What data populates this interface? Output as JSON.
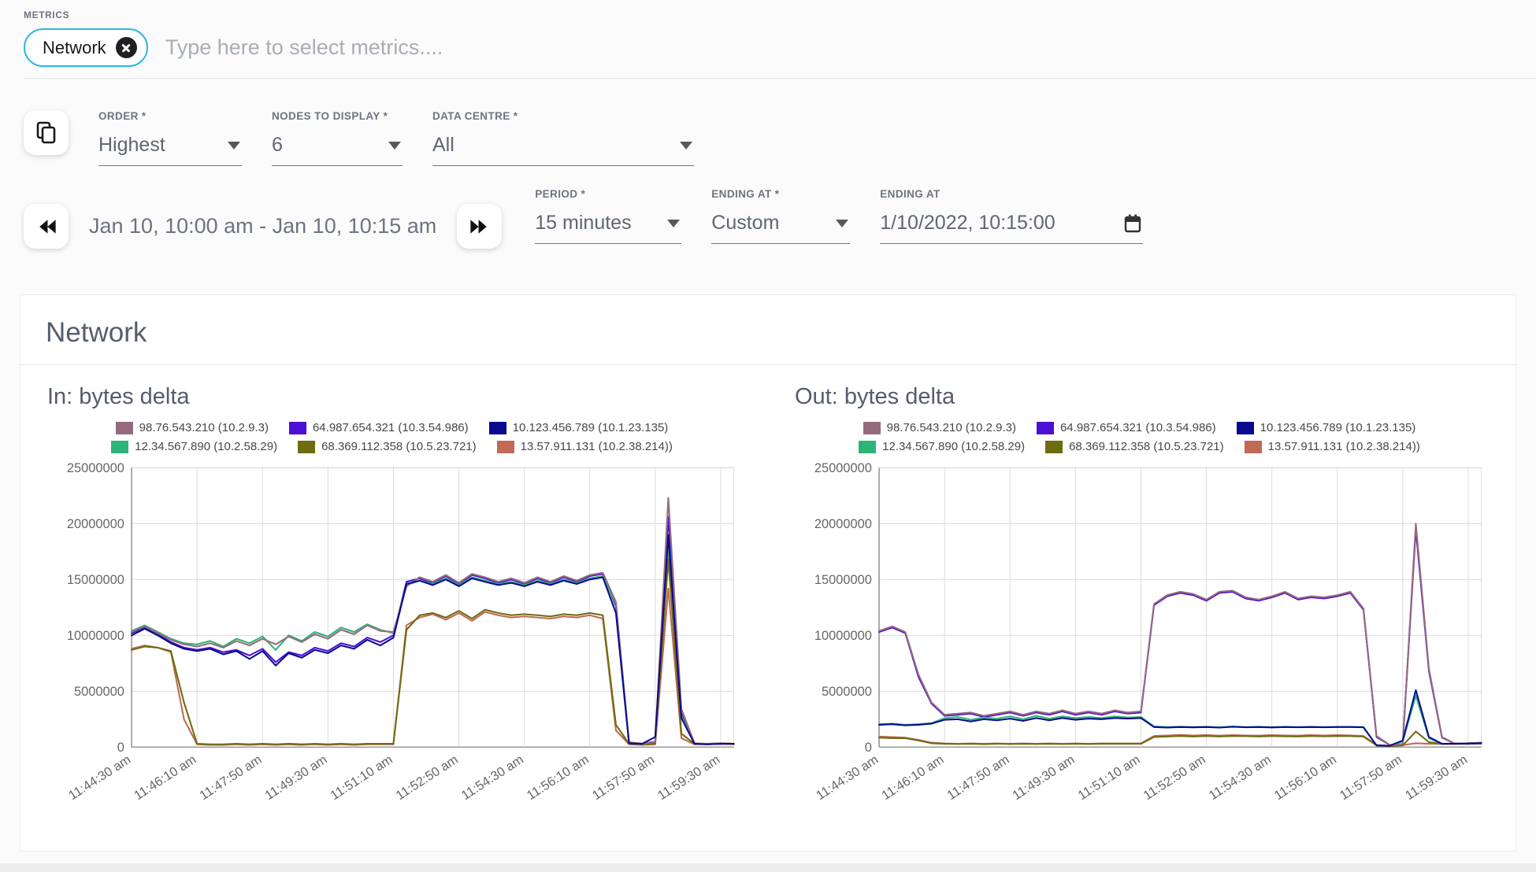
{
  "metrics": {
    "label": "METRICS",
    "chip": "Network",
    "placeholder": "Type here to select metrics...."
  },
  "controls": {
    "order": {
      "label": "ORDER *",
      "value": "Highest"
    },
    "nodes": {
      "label": "NODES TO DISPLAY *",
      "value": "6"
    },
    "data_centre": {
      "label": "DATA CENTRE *",
      "value": "All"
    }
  },
  "time_nav": {
    "range": "Jan 10, 10:00 am - Jan 10, 10:15 am",
    "period": {
      "label": "PERIOD *",
      "value": "15 minutes"
    },
    "ending_at_select": {
      "label": "ENDING AT *",
      "value": "Custom"
    },
    "ending_at_value": {
      "label": "ENDING AT",
      "value": "1/10/2022, 10:15:00"
    }
  },
  "card": {
    "title": "Network"
  },
  "icons": [
    "copy-icon",
    "rewind-icon",
    "fast-forward-icon",
    "calendar-icon",
    "chip-close-icon",
    "dropdown-caret-icon"
  ],
  "colors": {
    "accent": "#2bb7e2",
    "heading": "#565c6e",
    "label": "#6d7380",
    "value": "#5f6672",
    "placeholder": "#a9adb5",
    "axis_text": "#666666",
    "grid": "#dcdcdc",
    "axis_line": "#9b9b9b"
  },
  "chart_data": [
    {
      "type": "line",
      "title": "In: bytes delta",
      "xlabel": "",
      "ylabel": "",
      "ylim": [
        0,
        25000000
      ],
      "grid": true,
      "legend_position": "top",
      "y_ticks": [
        0,
        5000000,
        10000000,
        15000000,
        20000000,
        25000000
      ],
      "x_tick_labels": [
        "11:44:30 am",
        "11:46:10 am",
        "11:47:50 am",
        "11:49:30 am",
        "11:51:10 am",
        "11:52:50 am",
        "11:54:30 am",
        "11:56:10 am",
        "11:57:50 am",
        "11:59:30 am"
      ],
      "x_tick_indices": [
        0,
        5,
        10,
        15,
        20,
        25,
        30,
        35,
        40,
        45
      ],
      "series": [
        {
          "name": "98.76.543.210 (10.2.9.3)",
          "color": "#966a7e",
          "values": [
            10300000,
            10800000,
            10200000,
            9600000,
            9200000,
            9000000,
            9300000,
            8900000,
            9500000,
            9100000,
            9700000,
            9200000,
            9900000,
            9400000,
            10100000,
            9700000,
            10500000,
            10100000,
            10900000,
            10400000,
            10300000,
            14400000,
            15200000,
            14800000,
            15400000,
            14700000,
            15500000,
            15200000,
            14800000,
            15100000,
            14700000,
            15200000,
            14800000,
            15300000,
            14900000,
            15400000,
            15600000,
            13000000,
            450000,
            300000,
            500000,
            22300000,
            3400000,
            350000,
            300000,
            350000,
            300000
          ]
        },
        {
          "name": "64.987.654.321 (10.3.54.986)",
          "color": "#4c0fd4",
          "values": [
            10200000,
            10700000,
            10100000,
            9400000,
            8900000,
            8700000,
            8900000,
            8500000,
            8700000,
            8200000,
            8800000,
            7600000,
            8500000,
            8200000,
            8900000,
            8600000,
            9300000,
            9000000,
            9800000,
            9400000,
            10000000,
            14800000,
            15100000,
            14700000,
            15300000,
            14600000,
            15400000,
            15100000,
            14700000,
            15000000,
            14600000,
            15100000,
            14700000,
            15200000,
            14800000,
            15300000,
            15500000,
            12600000,
            400000,
            300000,
            500000,
            20600000,
            3000000,
            300000,
            250000,
            300000,
            300000
          ]
        },
        {
          "name": "10.123.456.789 (10.1.23.135)",
          "color": "#0a0a8f",
          "values": [
            10000000,
            10600000,
            10000000,
            9300000,
            8800000,
            8600000,
            8800000,
            8300000,
            8600000,
            7900000,
            8600000,
            7300000,
            8400000,
            8000000,
            8700000,
            8400000,
            9100000,
            8800000,
            9600000,
            9100000,
            9800000,
            14600000,
            14900000,
            14500000,
            15000000,
            14400000,
            15100000,
            14800000,
            14500000,
            14700000,
            14400000,
            14800000,
            14500000,
            14900000,
            14600000,
            15000000,
            15200000,
            12000000,
            350000,
            300000,
            900000,
            19000000,
            2600000,
            300000,
            250000,
            300000,
            300000
          ]
        },
        {
          "name": "12.34.567.890 (10.2.58.29)",
          "color": "#2db579",
          "values": [
            10400000,
            10900000,
            10300000,
            9700000,
            9300000,
            9200000,
            9500000,
            9000000,
            9700000,
            9300000,
            9900000,
            8700000,
            10000000,
            9500000,
            10300000,
            9900000,
            10700000,
            10300000,
            11000000,
            10500000,
            10200000,
            14500000,
            14900000,
            14600000,
            15100000,
            14500000,
            15200000,
            14900000,
            14600000,
            14800000,
            14500000,
            14900000,
            14600000,
            15000000,
            14700000,
            15100000,
            15300000,
            12800000,
            400000,
            300000,
            400000,
            18000000,
            2800000,
            300000,
            250000,
            300000,
            300000
          ]
        },
        {
          "name": "68.369.112.358 (10.5.23.721)",
          "color": "#6e6b10",
          "values": [
            8700000,
            9000000,
            8900000,
            8600000,
            4000000,
            300000,
            250000,
            250000,
            300000,
            250000,
            300000,
            250000,
            300000,
            250000,
            300000,
            250000,
            300000,
            250000,
            300000,
            300000,
            300000,
            10500000,
            11800000,
            12000000,
            11600000,
            12200000,
            11500000,
            12300000,
            12000000,
            11800000,
            11900000,
            11800000,
            11700000,
            11900000,
            11800000,
            12000000,
            11800000,
            2000000,
            300000,
            250000,
            300000,
            16800000,
            1200000,
            300000,
            300000,
            350000,
            300000
          ]
        },
        {
          "name": "13.57.911.131 (10.2.38.214))",
          "color": "#c06a55",
          "values": [
            8800000,
            9100000,
            8900000,
            8500000,
            2500000,
            250000,
            200000,
            200000,
            250000,
            200000,
            250000,
            200000,
            250000,
            200000,
            250000,
            200000,
            250000,
            200000,
            250000,
            250000,
            250000,
            10900000,
            11600000,
            11900000,
            11400000,
            12000000,
            11300000,
            12100000,
            11800000,
            11600000,
            11700000,
            11600000,
            11500000,
            11700000,
            11600000,
            11800000,
            11500000,
            1500000,
            250000,
            200000,
            250000,
            14200000,
            800000,
            250000,
            250000,
            300000,
            250000
          ]
        }
      ]
    },
    {
      "type": "line",
      "title": "Out: bytes delta",
      "xlabel": "",
      "ylabel": "",
      "ylim": [
        0,
        25000000
      ],
      "grid": true,
      "legend_position": "top",
      "y_ticks": [
        0,
        5000000,
        10000000,
        15000000,
        20000000,
        25000000
      ],
      "x_tick_labels": [
        "11:44:30 am",
        "11:46:10 am",
        "11:47:50 am",
        "11:49:30 am",
        "11:51:10 am",
        "11:52:50 am",
        "11:54:30 am",
        "11:56:10 am",
        "11:57:50 am",
        "11:59:30 am"
      ],
      "x_tick_indices": [
        0,
        5,
        10,
        15,
        20,
        25,
        30,
        35,
        40,
        45
      ],
      "series": [
        {
          "name": "98.76.543.210 (10.2.9.3)",
          "color": "#966a7e",
          "values": [
            10400000,
            10800000,
            10300000,
            6500000,
            4000000,
            2900000,
            3000000,
            3100000,
            2800000,
            3000000,
            3200000,
            2900000,
            3200000,
            3000000,
            3300000,
            3000000,
            3200000,
            3000000,
            3300000,
            3100000,
            3200000,
            12800000,
            13600000,
            13900000,
            13700000,
            13200000,
            13900000,
            14000000,
            13400000,
            13200000,
            13500000,
            13900000,
            13300000,
            13500000,
            13400000,
            13600000,
            13900000,
            12400000,
            1000000,
            200000,
            250000,
            20000000,
            7000000,
            900000,
            300000,
            350000,
            400000
          ]
        },
        {
          "name": "64.987.654.321 (10.3.54.986)",
          "color": "#4c0fd4",
          "values": [
            10300000,
            10700000,
            10200000,
            6300000,
            3900000,
            2800000,
            2900000,
            3000000,
            2700000,
            2900000,
            3100000,
            2800000,
            3100000,
            2900000,
            3200000,
            2900000,
            3100000,
            2900000,
            3200000,
            3000000,
            3100000,
            12700000,
            13500000,
            13800000,
            13600000,
            13100000,
            13800000,
            13900000,
            13300000,
            13100000,
            13400000,
            13800000,
            13200000,
            13400000,
            13300000,
            13500000,
            13800000,
            12300000,
            900000,
            200000,
            250000,
            19500000,
            6800000,
            850000,
            300000,
            350000,
            400000
          ]
        },
        {
          "name": "10.123.456.789 (10.1.23.135)",
          "color": "#0a0a8f",
          "values": [
            2000000,
            2050000,
            1950000,
            2000000,
            2100000,
            2450000,
            2500000,
            2300000,
            2500000,
            2400000,
            2550000,
            2350000,
            2600000,
            2400000,
            2600000,
            2450000,
            2550000,
            2500000,
            2600000,
            2550000,
            2600000,
            1800000,
            1750000,
            1800000,
            1770000,
            1800000,
            1750000,
            1820000,
            1780000,
            1800000,
            1760000,
            1800000,
            1780000,
            1800000,
            1780000,
            1800000,
            1800000,
            1780000,
            150000,
            120000,
            600000,
            5100000,
            900000,
            300000,
            300000,
            320000,
            350000
          ]
        },
        {
          "name": "12.34.567.890 (10.2.58.29)",
          "color": "#2db579",
          "values": [
            2050000,
            2100000,
            2000000,
            2050000,
            2150000,
            2600000,
            2700000,
            2450000,
            2650000,
            2550000,
            2750000,
            2500000,
            2800000,
            2550000,
            2750000,
            2600000,
            2700000,
            2600000,
            2750000,
            2650000,
            2700000,
            1850000,
            1800000,
            1830000,
            1800000,
            1830000,
            1780000,
            1850000,
            1800000,
            1820000,
            1790000,
            1820000,
            1800000,
            1820000,
            1800000,
            1820000,
            1820000,
            1800000,
            150000,
            120000,
            500000,
            4600000,
            800000,
            280000,
            300000,
            300000,
            330000
          ]
        },
        {
          "name": "68.369.112.358 (10.5.23.721)",
          "color": "#6e6b10",
          "values": [
            850000,
            800000,
            800000,
            600000,
            350000,
            300000,
            280000,
            300000,
            270000,
            300000,
            280000,
            300000,
            280000,
            300000,
            280000,
            300000,
            280000,
            300000,
            300000,
            300000,
            300000,
            900000,
            950000,
            1000000,
            950000,
            1000000,
            950000,
            1000000,
            980000,
            950000,
            1000000,
            970000,
            950000,
            1000000,
            970000,
            1000000,
            980000,
            950000,
            150000,
            100000,
            150000,
            1400000,
            450000,
            300000,
            330000,
            300000,
            350000
          ]
        },
        {
          "name": "13.57.911.131 (10.2.38.214))",
          "color": "#c06a55",
          "values": [
            950000,
            900000,
            850000,
            650000,
            400000,
            330000,
            300000,
            330000,
            300000,
            330000,
            300000,
            330000,
            300000,
            330000,
            300000,
            330000,
            300000,
            330000,
            330000,
            330000,
            330000,
            1000000,
            1050000,
            1100000,
            1050000,
            1080000,
            1030000,
            1080000,
            1050000,
            1030000,
            1080000,
            1050000,
            1030000,
            1080000,
            1050000,
            1080000,
            1050000,
            1000000,
            200000,
            120000,
            180000,
            350000,
            300000,
            280000,
            300000,
            300000,
            320000
          ]
        }
      ]
    }
  ]
}
